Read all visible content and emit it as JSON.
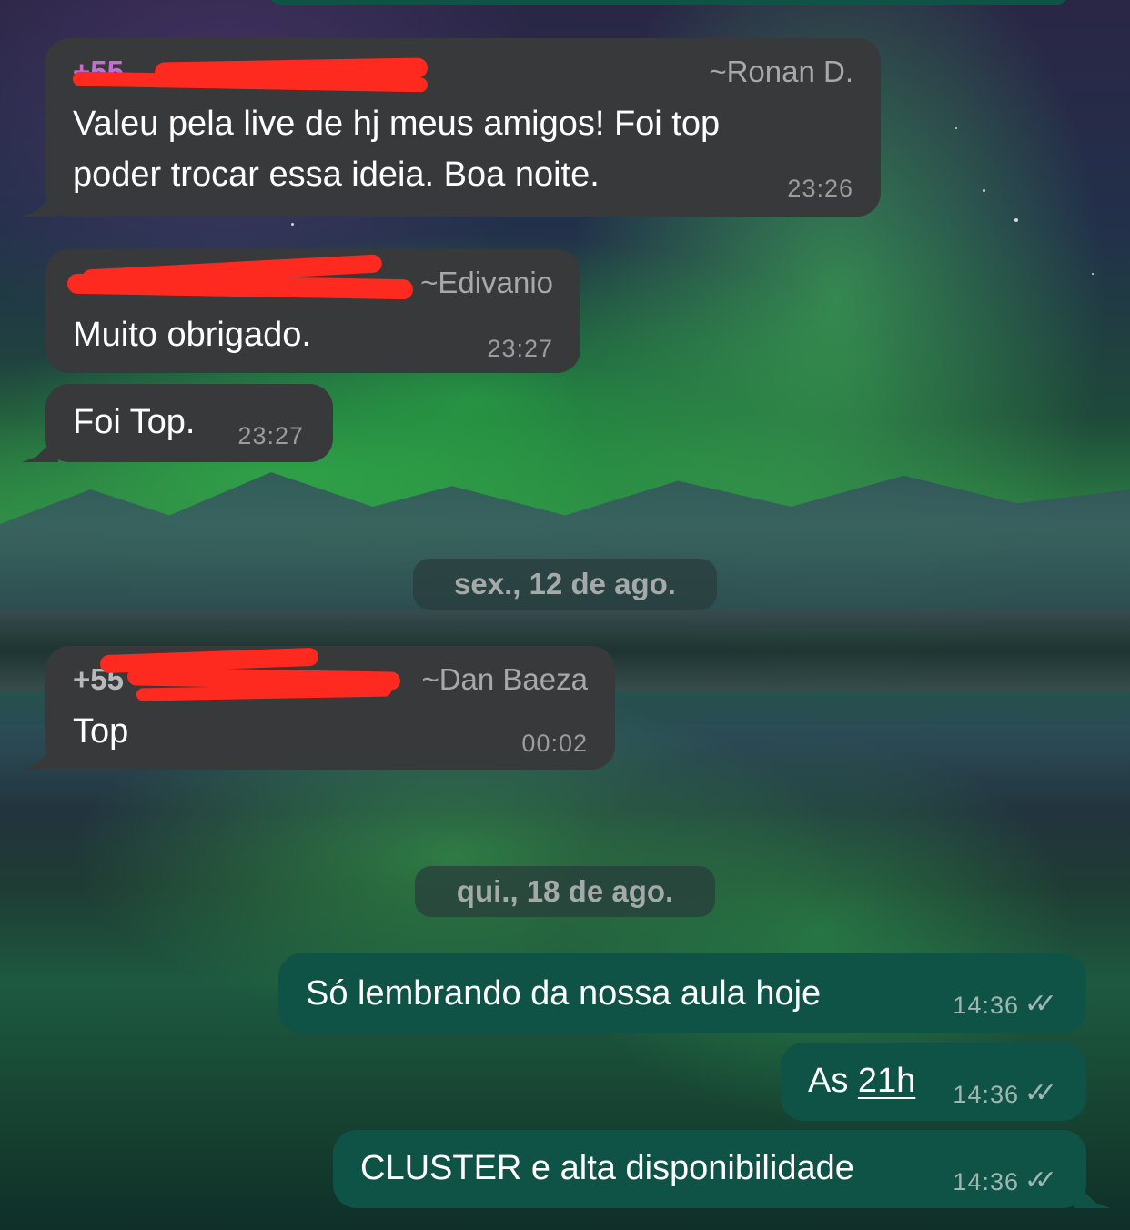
{
  "messages": [
    {
      "sender_phone": "+55",
      "sender_name": "~Ronan D.",
      "text_line1": "Valeu pela live de hj meus amigos! Foi top",
      "text_line2": "poder trocar essa ideia. Boa noite.",
      "time": "23:26"
    },
    {
      "sender_phone": "",
      "sender_name": "~Edivanio",
      "text": "Muito obrigado.",
      "time": "23:27"
    },
    {
      "text": "Foi Top.",
      "time": "23:27"
    },
    {
      "sender_phone": "+55",
      "sender_name": "~Dan Baeza",
      "text": "Top",
      "time": "00:02"
    },
    {
      "text": "Só lembrando da nossa aula hoje",
      "time": "14:36"
    },
    {
      "text_prefix": "As ",
      "text_link": "21h",
      "time": "14:36"
    },
    {
      "text": "CLUSTER e alta disponibilidade",
      "time": "14:36"
    }
  ],
  "date_separators": [
    "sex., 12 de ago.",
    "qui., 18 de ago."
  ],
  "ticks": "✓✓",
  "colors": {
    "incoming_bubble": "#38393b",
    "outgoing_bubble": "#0f5246",
    "redaction": "#ff2a1f",
    "sender_phone_1": "#c96bd6",
    "sender_phone_2": "#d6e64a",
    "sender_phone_3": "#b9b9bb"
  }
}
